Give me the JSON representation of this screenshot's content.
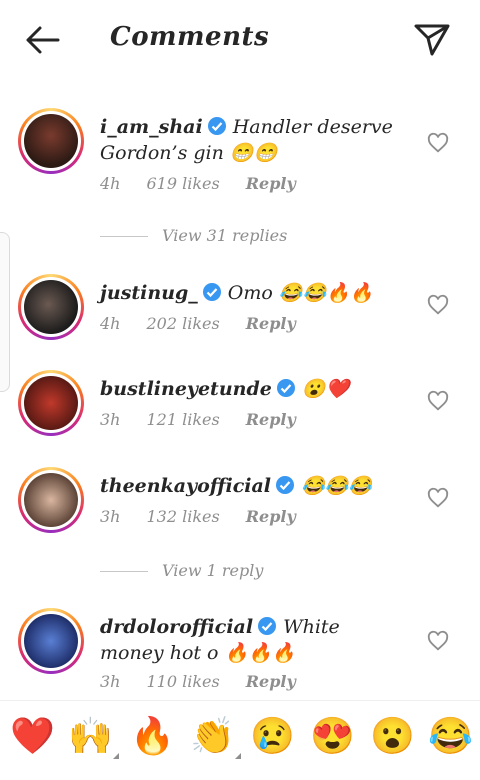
{
  "header": {
    "title": "Comments"
  },
  "comments": [
    {
      "username": "i_am_shai",
      "text": "Handler deserve Gordon’s gin 😁😁",
      "time": "4h",
      "likes": "619 likes",
      "reply": "Reply"
    },
    {
      "username": "justinug_",
      "text": "Omo 😂😂🔥🔥",
      "time": "4h",
      "likes": "202 likes",
      "reply": "Reply"
    },
    {
      "username": "bustlineyetunde",
      "text": "😮❤️",
      "time": "3h",
      "likes": "121 likes",
      "reply": "Reply"
    },
    {
      "username": "theenkayofficial",
      "text": "😂😂😂",
      "time": "3h",
      "likes": "132 likes",
      "reply": "Reply"
    },
    {
      "username": "drdolorofficial",
      "text": "White money hot o 🔥🔥🔥",
      "time": "3h",
      "likes": "110 likes",
      "reply": "Reply"
    }
  ],
  "view_replies": [
    "View 31 replies",
    "View 1 reply"
  ],
  "emoji_bar": [
    "❤️",
    "🙌",
    "🔥",
    "👏",
    "😢",
    "😍",
    "😮",
    "😂"
  ],
  "colors": {
    "verified": "#3897f0",
    "muted": "#8e8e8e",
    "text": "#262626"
  }
}
